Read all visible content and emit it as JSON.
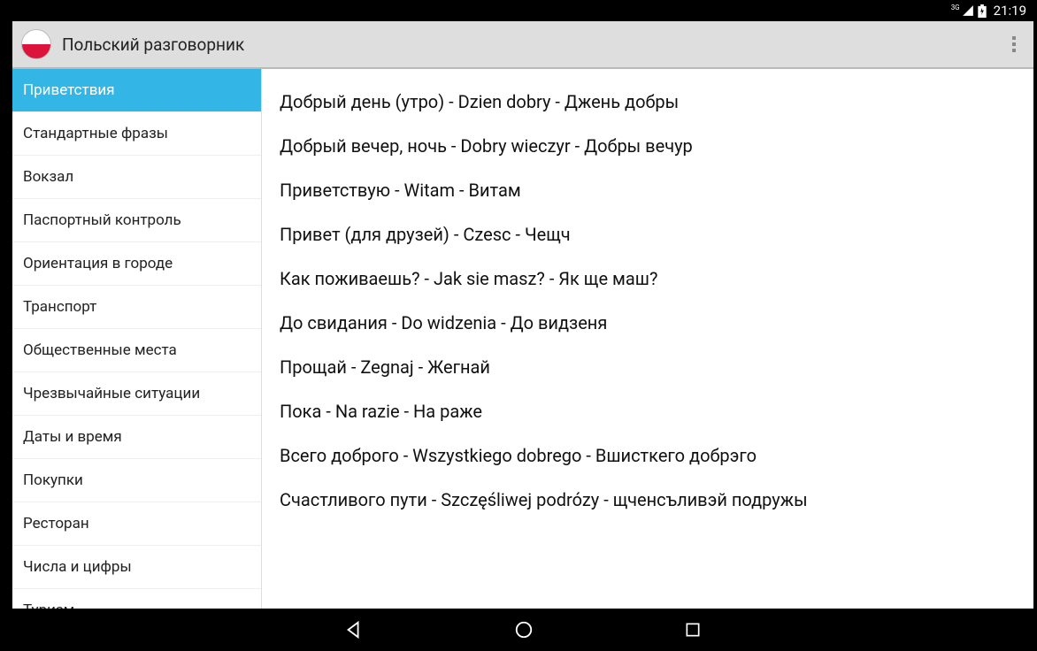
{
  "status": {
    "network_label": "3G",
    "time": "21:19"
  },
  "header": {
    "title": "Польский разговорник"
  },
  "sidebar": {
    "items": [
      {
        "label": "Приветствия",
        "active": true
      },
      {
        "label": "Стандартные фразы",
        "active": false
      },
      {
        "label": "Вокзал",
        "active": false
      },
      {
        "label": "Паспортный контроль",
        "active": false
      },
      {
        "label": "Ориентация в городе",
        "active": false
      },
      {
        "label": "Транспорт",
        "active": false
      },
      {
        "label": "Общественные места",
        "active": false
      },
      {
        "label": "Чрезвычайные ситуации",
        "active": false
      },
      {
        "label": "Даты и время",
        "active": false
      },
      {
        "label": "Покупки",
        "active": false
      },
      {
        "label": "Ресторан",
        "active": false
      },
      {
        "label": "Числа и цифры",
        "active": false
      },
      {
        "label": "Туризм",
        "active": false
      }
    ]
  },
  "phrases": [
    "Добрый день (утро) - Dzien dobry - Джень добры",
    "Добрый вечер, ночь - Dobry wieczyr - Добры вечур",
    "Приветствую - Witam - Витам",
    "Привет (для друзей) - Czesc - Чещч",
    "Как поживаешь? - Jak sie masz? - Як ще маш?",
    "До свидания - Do widzenia - До видзеня",
    "Прощай - Zegnaj - Жегнай",
    "Пока - Na razie - На раже",
    "Всего доброго - Wszystkiego dobrego - Вшисткего добрэго",
    "Счастливого пути - Szczęśliwej podrózy - щченсъливэй подружы"
  ]
}
